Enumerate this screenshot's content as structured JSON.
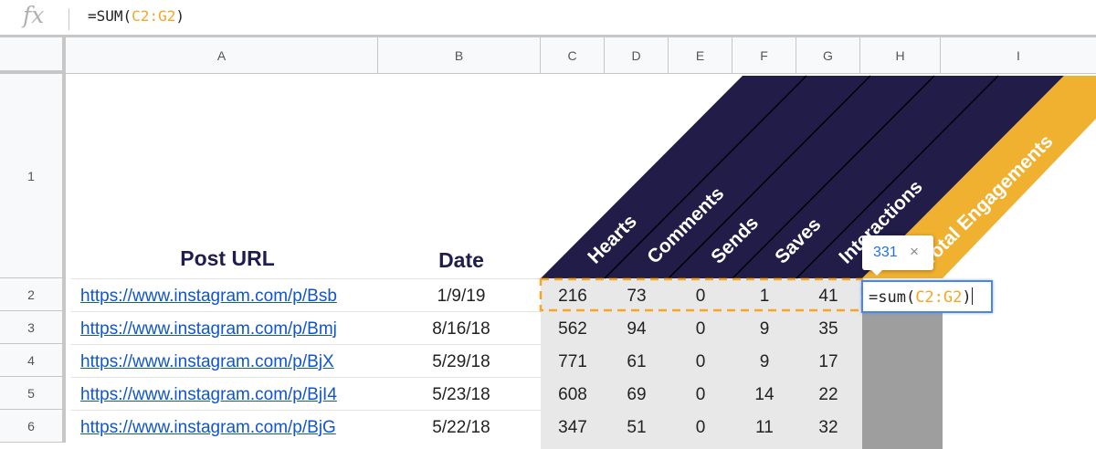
{
  "formula_bar": {
    "fx_label": "fx",
    "prefix": "=SUM(",
    "range": "C2:G2",
    "suffix": ")"
  },
  "columns": [
    "A",
    "B",
    "C",
    "D",
    "E",
    "F",
    "G",
    "H",
    "I"
  ],
  "rows": [
    "1",
    "2",
    "3",
    "4",
    "5",
    "6"
  ],
  "header": {
    "post_url": "Post URL",
    "date": "Date",
    "hearts": "Hearts",
    "comments": "Comments",
    "sends": "Sends",
    "saves": "Saves",
    "interactions": "Interactions",
    "total": "Total Engagements"
  },
  "data_rows": [
    {
      "url": "https://www.instagram.com/p/Bsb",
      "date": "1/9/19",
      "hearts": "216",
      "comments": "73",
      "sends": "0",
      "saves": "1",
      "interactions": "41"
    },
    {
      "url": "https://www.instagram.com/p/Bmj",
      "date": "8/16/18",
      "hearts": "562",
      "comments": "94",
      "sends": "0",
      "saves": "9",
      "interactions": "35"
    },
    {
      "url": "https://www.instagram.com/p/BjX",
      "date": "5/29/18",
      "hearts": "771",
      "comments": "61",
      "sends": "0",
      "saves": "9",
      "interactions": "17"
    },
    {
      "url": "https://www.instagram.com/p/BjI4",
      "date": "5/23/18",
      "hearts": "608",
      "comments": "69",
      "sends": "0",
      "saves": "14",
      "interactions": "22"
    },
    {
      "url": "https://www.instagram.com/p/BjG",
      "date": "5/22/18",
      "hearts": "347",
      "comments": "51",
      "sends": "0",
      "saves": "11",
      "interactions": "32"
    }
  ],
  "tooltip": {
    "value": "331",
    "close": "×"
  },
  "editor": {
    "prefix": "=sum(",
    "range": "C2:G2",
    "suffix": ")"
  },
  "colors": {
    "header_band": "#211c48",
    "accent": "#f0b030",
    "link": "#1155cc",
    "range_highlight": "#f5a623",
    "selection": "#4a86e8"
  }
}
